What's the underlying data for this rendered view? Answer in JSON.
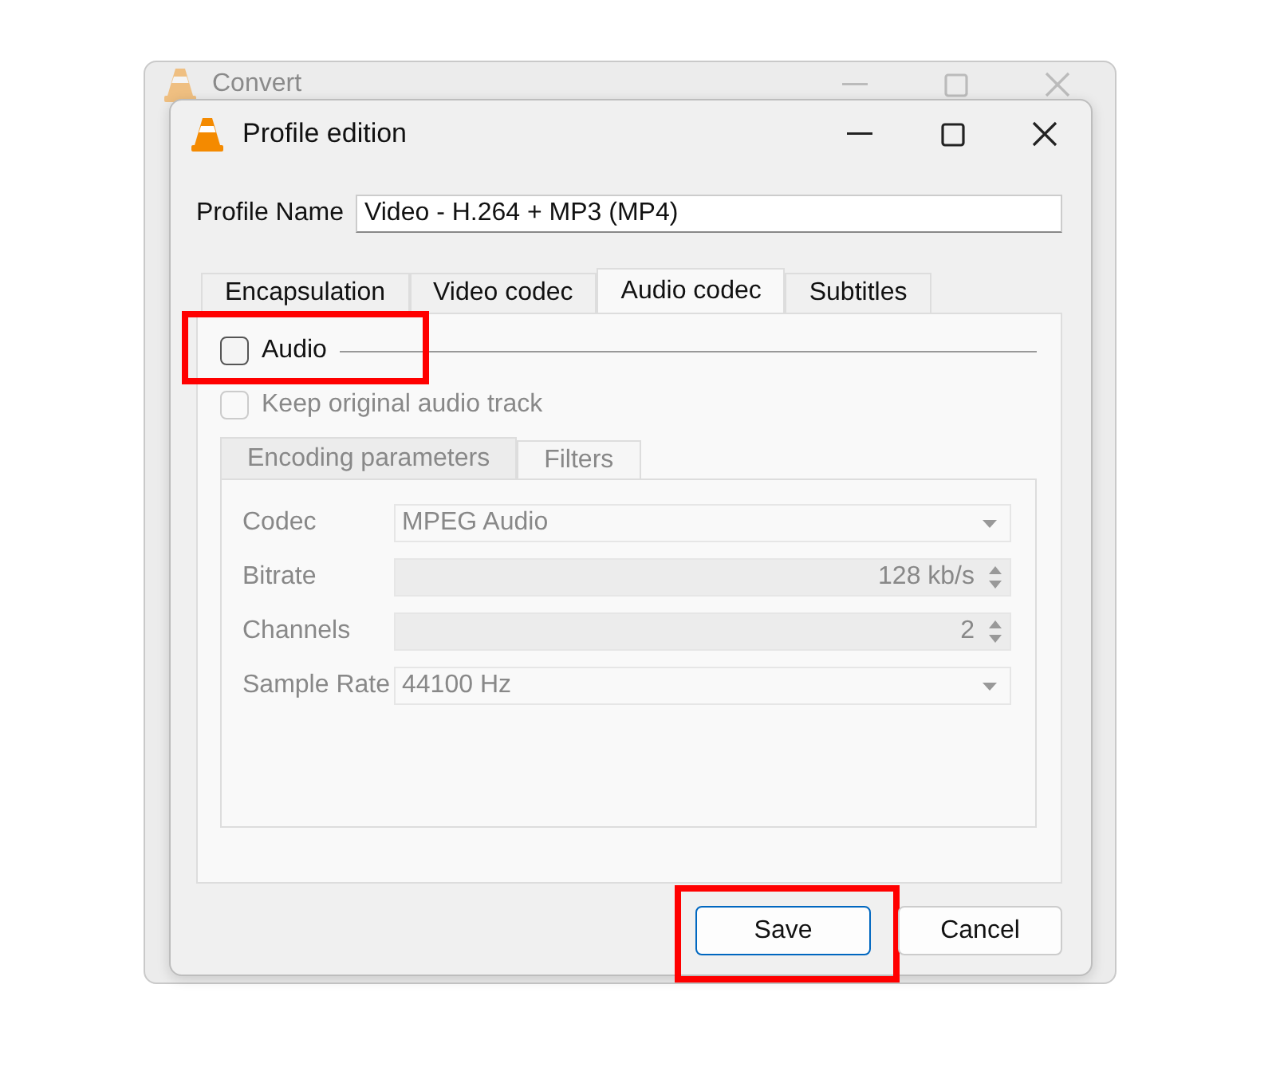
{
  "background_window": {
    "title": "Convert"
  },
  "window": {
    "title": "Profile edition"
  },
  "profile_name": {
    "label": "Profile Name",
    "value": "Video - H.264 + MP3 (MP4)"
  },
  "tabs": [
    {
      "label": "Encapsulation",
      "selected": false
    },
    {
      "label": "Video codec",
      "selected": false
    },
    {
      "label": "Audio codec",
      "selected": true
    },
    {
      "label": "Subtitles",
      "selected": false
    }
  ],
  "audio": {
    "label": "Audio",
    "checked": false,
    "highlighted": true
  },
  "keep_original": {
    "label": "Keep original audio track",
    "checked": false,
    "disabled": true
  },
  "sub_tabs": [
    {
      "label": "Encoding parameters",
      "selected": true
    },
    {
      "label": "Filters",
      "selected": false
    }
  ],
  "fields": [
    {
      "label": "Codec",
      "kind": "dropdown",
      "value": "MPEG Audio",
      "disabled": true
    },
    {
      "label": "Bitrate",
      "kind": "spinbox",
      "value": "128 kb/s",
      "disabled": true
    },
    {
      "label": "Channels",
      "kind": "spinbox",
      "value": "2",
      "disabled": true
    },
    {
      "label": "Sample Rate",
      "kind": "dropdown",
      "value": "44100 Hz",
      "disabled": true
    }
  ],
  "buttons": [
    {
      "label": "Save",
      "default": true,
      "highlighted": true
    },
    {
      "label": "Cancel",
      "default": false,
      "highlighted": false
    }
  ]
}
